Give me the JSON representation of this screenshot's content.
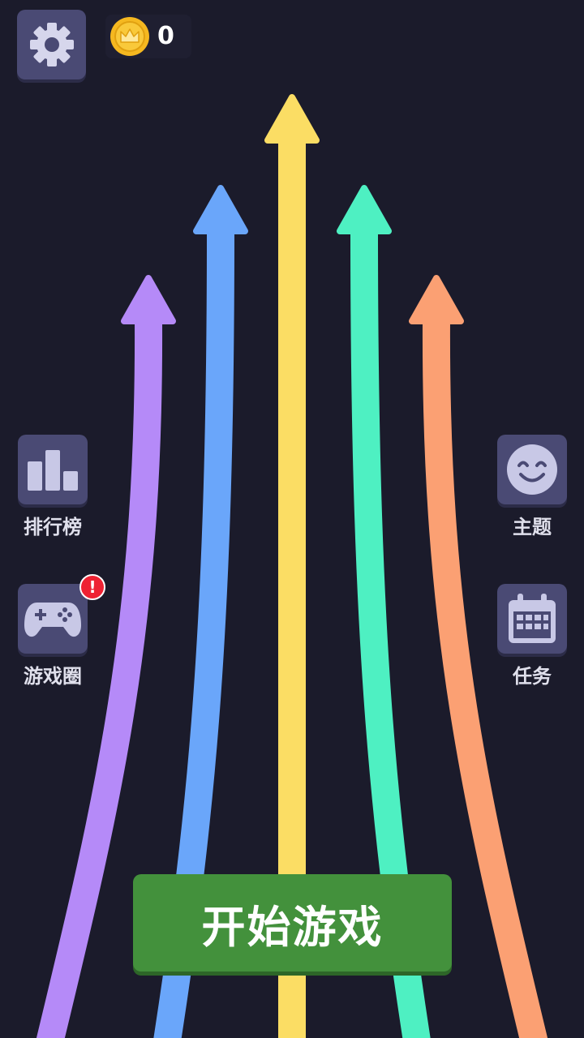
{
  "header": {
    "settings_icon": "gear-icon",
    "coin_icon": "crown-coin-icon",
    "coin_count": "0"
  },
  "menu": {
    "leaderboard": {
      "label": "排行榜",
      "icon": "bar-chart-icon"
    },
    "game_circle": {
      "label": "游戏圈",
      "icon": "gamepad-icon",
      "badge": "!"
    },
    "theme": {
      "label": "主题",
      "icon": "smiley-icon"
    },
    "tasks": {
      "label": "任务",
      "icon": "calendar-icon"
    }
  },
  "start_button": {
    "label": "开始游戏"
  },
  "colors": {
    "background": "#1b1b2b",
    "button_bg": "#4a4a74",
    "start_green": "#43913c",
    "arrows": [
      "#b58af8",
      "#6aa6fa",
      "#fbdd64",
      "#4ef0c2",
      "#fba073"
    ]
  }
}
